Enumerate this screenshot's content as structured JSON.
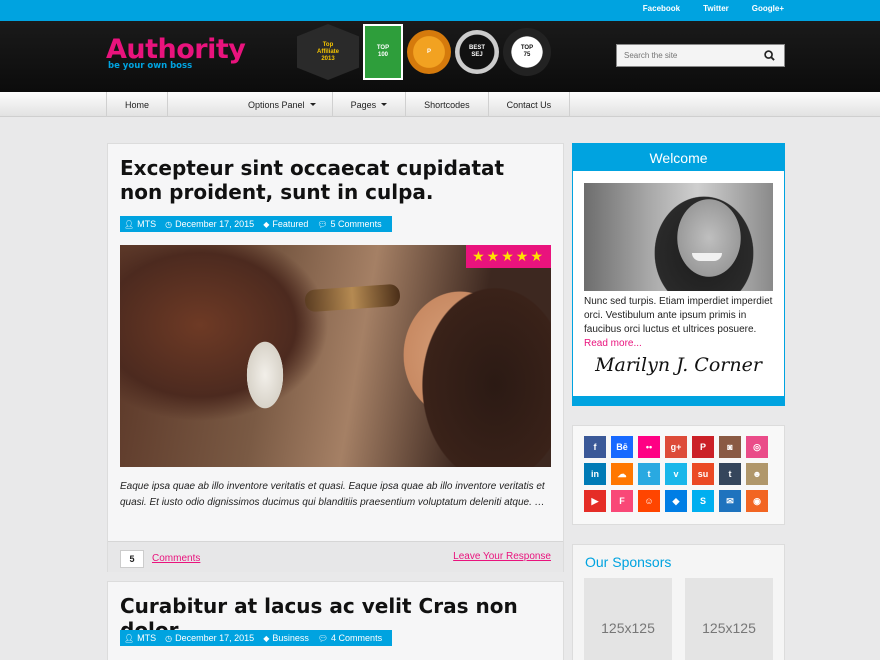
{
  "topbar": {
    "links": [
      "Facebook",
      "Twitter",
      "Google+"
    ]
  },
  "header": {
    "logo_title": "Authority",
    "logo_tagline": "be your own boss",
    "badges": [
      "Top Affiliate Marketing Blog 2013",
      "Technorati Top 100 Business Blog",
      "ProBlogger One to Watch 2013",
      "Best SEJ Award",
      "Top 75 Unbounce Award"
    ],
    "search_placeholder": "Search the site"
  },
  "nav": {
    "items": [
      {
        "label": "Home"
      },
      {
        "label": "Options Panel"
      },
      {
        "label": "Pages"
      },
      {
        "label": "Shortcodes"
      },
      {
        "label": "Contact Us"
      }
    ]
  },
  "posts": [
    {
      "title": "Excepteur sint occaecat cupidatat non proident, sunt in culpa.",
      "author": "MTS",
      "date": "December 17, 2015",
      "category": "Featured",
      "comments": "5 Comments",
      "rating_stars": 5,
      "excerpt": "Eaque ipsa quae ab illo inventore veritatis et quasi. Eaque ipsa quae ab illo inventore veritatis et quasi. Et iusto odio dignissimos ducimus qui blanditiis praesentium voluptatum deleniti atque. …",
      "comment_count": "5",
      "comments_link": "Comments",
      "leave_response": "Leave Your Response"
    },
    {
      "title": "Curabitur at lacus ac velit Cras non dolor",
      "author": "MTS",
      "date": "December 17, 2015",
      "category": "Business",
      "comments": "4 Comments"
    }
  ],
  "sidebar": {
    "welcome": {
      "title": "Welcome",
      "text": "Nunc sed turpis. Etiam imperdiet imperdiet orci. Vestibulum ante ipsum primis in faucibus orci luctus et ultrices posuere.",
      "read_more": "Read more...",
      "signature": "Marilyn J. Corner"
    },
    "social": [
      {
        "name": "facebook-icon",
        "glyph": "f",
        "color": "#3b5998"
      },
      {
        "name": "behance-icon",
        "glyph": "Bē",
        "color": "#1769ff"
      },
      {
        "name": "flickr-icon",
        "glyph": "••",
        "color": "#ff0084"
      },
      {
        "name": "googleplus-icon",
        "glyph": "g+",
        "color": "#dd4b39"
      },
      {
        "name": "pinterest-icon",
        "glyph": "P",
        "color": "#cb2027"
      },
      {
        "name": "instagram-icon",
        "glyph": "◙",
        "color": "#8a5a44"
      },
      {
        "name": "dribbble-icon",
        "glyph": "◎",
        "color": "#ea4c89"
      },
      {
        "name": "linkedin-icon",
        "glyph": "in",
        "color": "#007bb6"
      },
      {
        "name": "soundcloud-icon",
        "glyph": "☁",
        "color": "#ff7700"
      },
      {
        "name": "twitter-icon",
        "glyph": "t",
        "color": "#29a9e1"
      },
      {
        "name": "vimeo-icon",
        "glyph": "v",
        "color": "#1ab7ea"
      },
      {
        "name": "stumbleupon-icon",
        "glyph": "su",
        "color": "#eb4924"
      },
      {
        "name": "tumblr-icon",
        "glyph": "t",
        "color": "#35465c"
      },
      {
        "name": "github-icon",
        "glyph": "☻",
        "color": "#b0976b"
      },
      {
        "name": "youtube-icon",
        "glyph": "▶",
        "color": "#e52d27"
      },
      {
        "name": "foursquare-icon",
        "glyph": "F",
        "color": "#f94877"
      },
      {
        "name": "reddit-icon",
        "glyph": "☺",
        "color": "#ff4500"
      },
      {
        "name": "dropbox-icon",
        "glyph": "◆",
        "color": "#007ee5"
      },
      {
        "name": "skype-icon",
        "glyph": "S",
        "color": "#00aff0"
      },
      {
        "name": "email-icon",
        "glyph": "✉",
        "color": "#1e73be"
      },
      {
        "name": "rss-icon",
        "glyph": "◉",
        "color": "#f26522"
      }
    ],
    "sponsors": {
      "title": "Our Sponsors",
      "ads": [
        "125x125",
        "125x125"
      ]
    }
  },
  "colors": {
    "accent_blue": "#00a3e0",
    "accent_pink": "#e9137d",
    "star_yellow": "#ffe200"
  }
}
